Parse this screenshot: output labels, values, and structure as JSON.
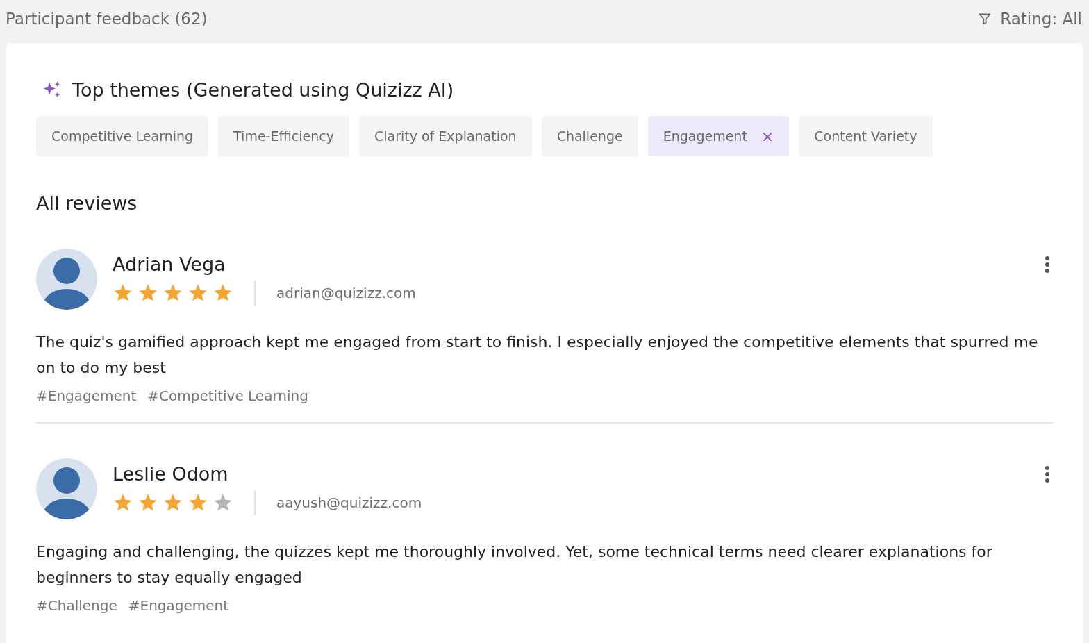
{
  "header": {
    "title": "Participant feedback (62)",
    "filter": "Rating: All"
  },
  "themes": {
    "title": "Top themes (Generated using Quizizz AI)",
    "chips": [
      {
        "label": "Competitive Learning",
        "selected": false
      },
      {
        "label": "Time-Efficiency",
        "selected": false
      },
      {
        "label": "Clarity of Explanation",
        "selected": false
      },
      {
        "label": "Challenge",
        "selected": false
      },
      {
        "label": "Engagement",
        "selected": true,
        "remove": "×"
      },
      {
        "label": "Content Variety",
        "selected": false
      }
    ]
  },
  "reviews_title": "All reviews",
  "reviews": [
    {
      "name": "Adrian Vega",
      "stars": 5,
      "email": "adrian@quizizz.com",
      "text": "The quiz's gamified approach kept me engaged from start to finish. I especially enjoyed the competitive elements that spurred me on to do my best",
      "tags": [
        "#Engagement",
        "#Competitive Learning"
      ]
    },
    {
      "name": "Leslie Odom",
      "stars": 4,
      "email": "aayush@quizizz.com",
      "text": "Engaging and challenging, the quizzes kept me thoroughly involved. Yet, some technical terms need clearer explanations for beginners to stay equally engaged",
      "tags": [
        "#Challenge",
        "#Engagement"
      ]
    }
  ]
}
